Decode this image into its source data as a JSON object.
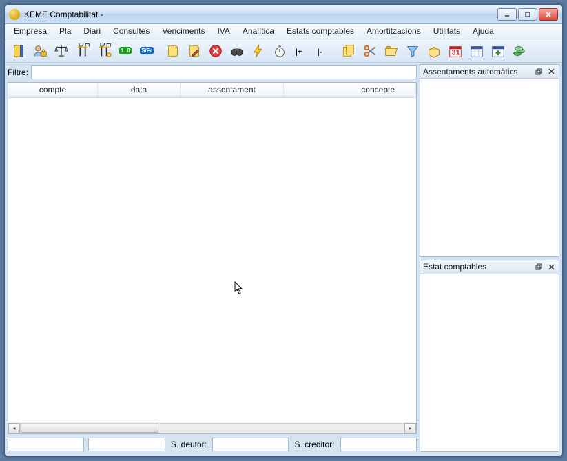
{
  "window": {
    "title": "KEME Comptabilitat -"
  },
  "menu": [
    "Empresa",
    "Pla",
    "Diari",
    "Consultes",
    "Venciments",
    "IVA",
    "Analítica",
    "Estats comptables",
    "Amortitzacions",
    "Utilitats",
    "Ajuda"
  ],
  "toolbar_icons": [
    "book-icon",
    "user-lock-icon",
    "balance-icon",
    "letter-d-icon",
    "letter-h-icon",
    "numeric-badge-icon",
    "sfr-badge-icon",
    "note-icon",
    "edit-note-icon",
    "cancel-icon",
    "binoculars-icon",
    "lightning-icon",
    "stopwatch-icon",
    "increment-icon",
    "decrement-icon",
    "notes-stack-icon",
    "scissors-icon",
    "folder-open-icon",
    "filter-icon",
    "box-open-icon",
    "calendar-red-icon",
    "calendar-grid-icon",
    "calendar-plus-icon",
    "money-icon"
  ],
  "filter": {
    "label": "Filtre:",
    "value": ""
  },
  "table": {
    "columns": [
      "compte",
      "data",
      "assentament",
      "concepte"
    ],
    "rows": []
  },
  "footer": {
    "debtor_label": "S. deutor:",
    "creditor_label": "S. creditor:",
    "field1": "",
    "field2": "",
    "debtor_value": "",
    "creditor_value": ""
  },
  "panels": {
    "auto_title": "Assentaments automàtics",
    "state_title": "Estat comptables"
  },
  "colors": {
    "accent": "#d6e4f2",
    "border": "#a8b9cf"
  }
}
